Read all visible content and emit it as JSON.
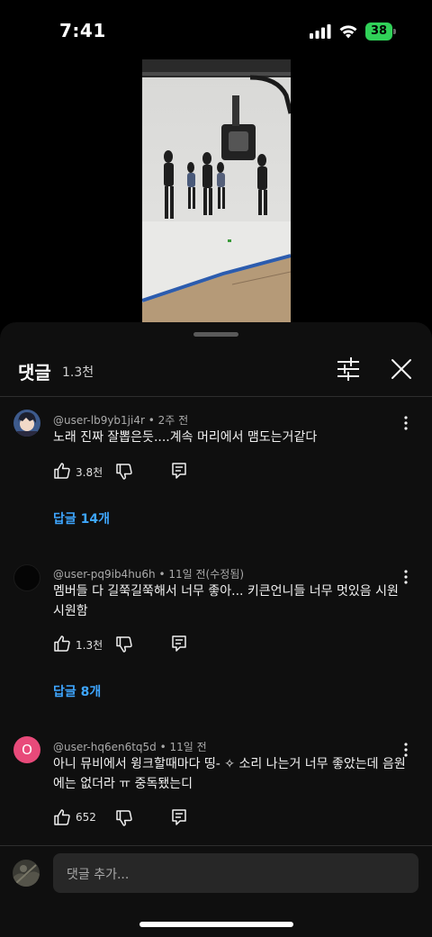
{
  "status_bar": {
    "time": "7:41",
    "battery": "38",
    "signal_icon": "cellular-signal-icon",
    "wifi_icon": "wifi-icon"
  },
  "video": {
    "thumbnail": "dance-practice-studio-video"
  },
  "comments_sheet": {
    "title": "댓글",
    "count": "1.3천",
    "filter_icon": "sliders-icon",
    "close_icon": "close-icon",
    "comments": [
      {
        "author": "@user-lb9yb1ji4r",
        "time": "2주 전",
        "text": "노래 진짜 잘뽑은듯....계속 머리에서 맴도는거같다",
        "likes": "3.8천",
        "replies": "답글 14개",
        "avatar": "anime-character-avatar"
      },
      {
        "author": "@user-pq9ib4hu6h",
        "time": "11일 전(수정됨)",
        "text": "멤버들 다 길쭉길쭉해서 너무 좋아... 키큰언니들 너무 멋있음 시원 시원함",
        "likes": "1.3천",
        "replies": "답글 8개",
        "avatar": "black-circle-avatar"
      },
      {
        "author": "@user-hq6en6tq5d",
        "time": "11일 전",
        "text": "아니 뮤비에서 윙크할때마다 띵- ✧ 소리 나는거 너무 좋았는데 음원에는 없더라 ㅠ 중독됐는디",
        "likes": "652",
        "avatar_letter": "O",
        "avatar_color": "#e84a7a"
      }
    ],
    "compose_placeholder": "댓글 추가..."
  },
  "colors": {
    "sheet_bg": "#0f0f0f",
    "link_blue": "#3ea6ff",
    "battery_green": "#30d158"
  }
}
